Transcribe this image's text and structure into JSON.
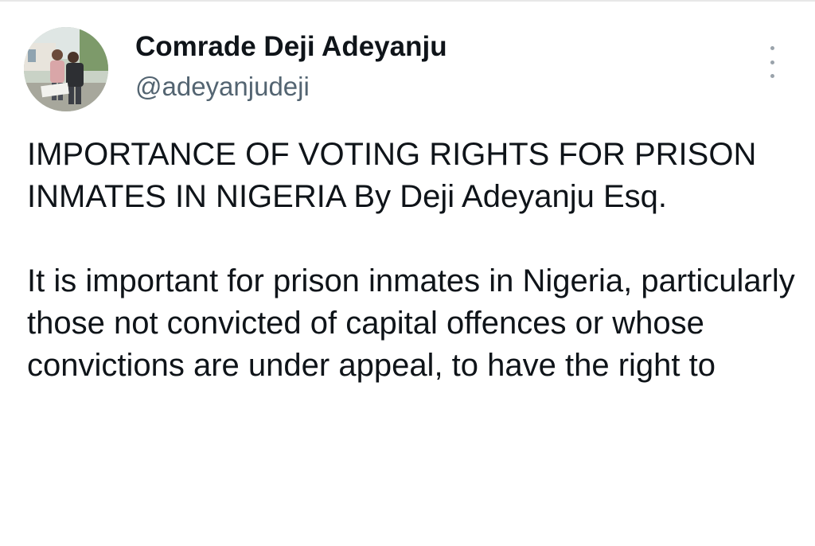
{
  "tweet": {
    "author": {
      "display_name": "Comrade Deji Adeyanju",
      "handle": "@adeyanjudeji"
    },
    "more_icon": "more-vertical-icon",
    "paragraphs": [
      "IMPORTANCE OF VOTING RIGHTS FOR PRISON INMATES IN NIGERIA By Deji Adeyanju Esq.",
      "It is important for prison inmates in Nigeria, particularly those not convicted of capital offences or whose convictions are under appeal, to have the right to"
    ]
  },
  "colors": {
    "text_primary": "#0f1419",
    "text_secondary": "#536471",
    "icon_gray": "#9aa3ab",
    "background": "#ffffff"
  }
}
